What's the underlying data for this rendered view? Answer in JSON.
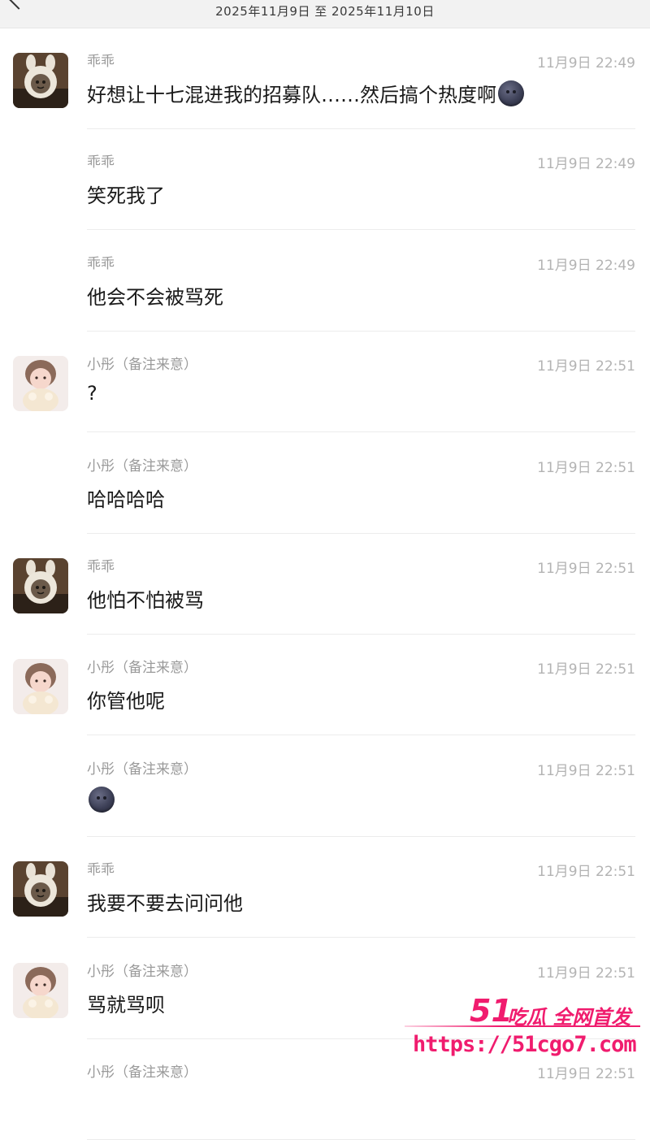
{
  "header": {
    "date_range": "2025年11月9日 至 2025年11月10日"
  },
  "messages": [
    {
      "sender": "乖乖",
      "time": "11月9日 22:49",
      "text": "好想让十七混进我的招募队……然后搞个热度啊",
      "avatar": "guaiguai",
      "emoji": true
    },
    {
      "sender": "乖乖",
      "time": "11月9日 22:49",
      "text": "笑死我了",
      "avatar": ""
    },
    {
      "sender": "乖乖",
      "time": "11月9日 22:49",
      "text": "他会不会被骂死",
      "avatar": ""
    },
    {
      "sender": "小彤（备注来意）",
      "time": "11月9日 22:51",
      "text": "?",
      "avatar": "xiaotong"
    },
    {
      "sender": "小彤（备注来意）",
      "time": "11月9日 22:51",
      "text": "哈哈哈哈",
      "avatar": ""
    },
    {
      "sender": "乖乖",
      "time": "11月9日 22:51",
      "text": "他怕不怕被骂",
      "avatar": "guaiguai"
    },
    {
      "sender": "小彤（备注来意）",
      "time": "11月9日 22:51",
      "text": "你管他呢",
      "avatar": "xiaotong"
    },
    {
      "sender": "小彤（备注来意）",
      "time": "11月9日 22:51",
      "text": "",
      "avatar": "",
      "emoji": true
    },
    {
      "sender": "乖乖",
      "time": "11月9日 22:51",
      "text": "我要不要去问问他",
      "avatar": "guaiguai"
    },
    {
      "sender": "小彤（备注来意）",
      "time": "11月9日 22:51",
      "text": "骂就骂呗",
      "avatar": "xiaotong"
    },
    {
      "sender": "小彤（备注来意）",
      "time": "11月9日 22:51",
      "text": "",
      "avatar": ""
    }
  ],
  "watermark": {
    "brand": "51",
    "tag": "吃瓜 全网首发",
    "url": "https://51cgo7.com"
  },
  "colors": {
    "watermark": "#f01c6e"
  }
}
